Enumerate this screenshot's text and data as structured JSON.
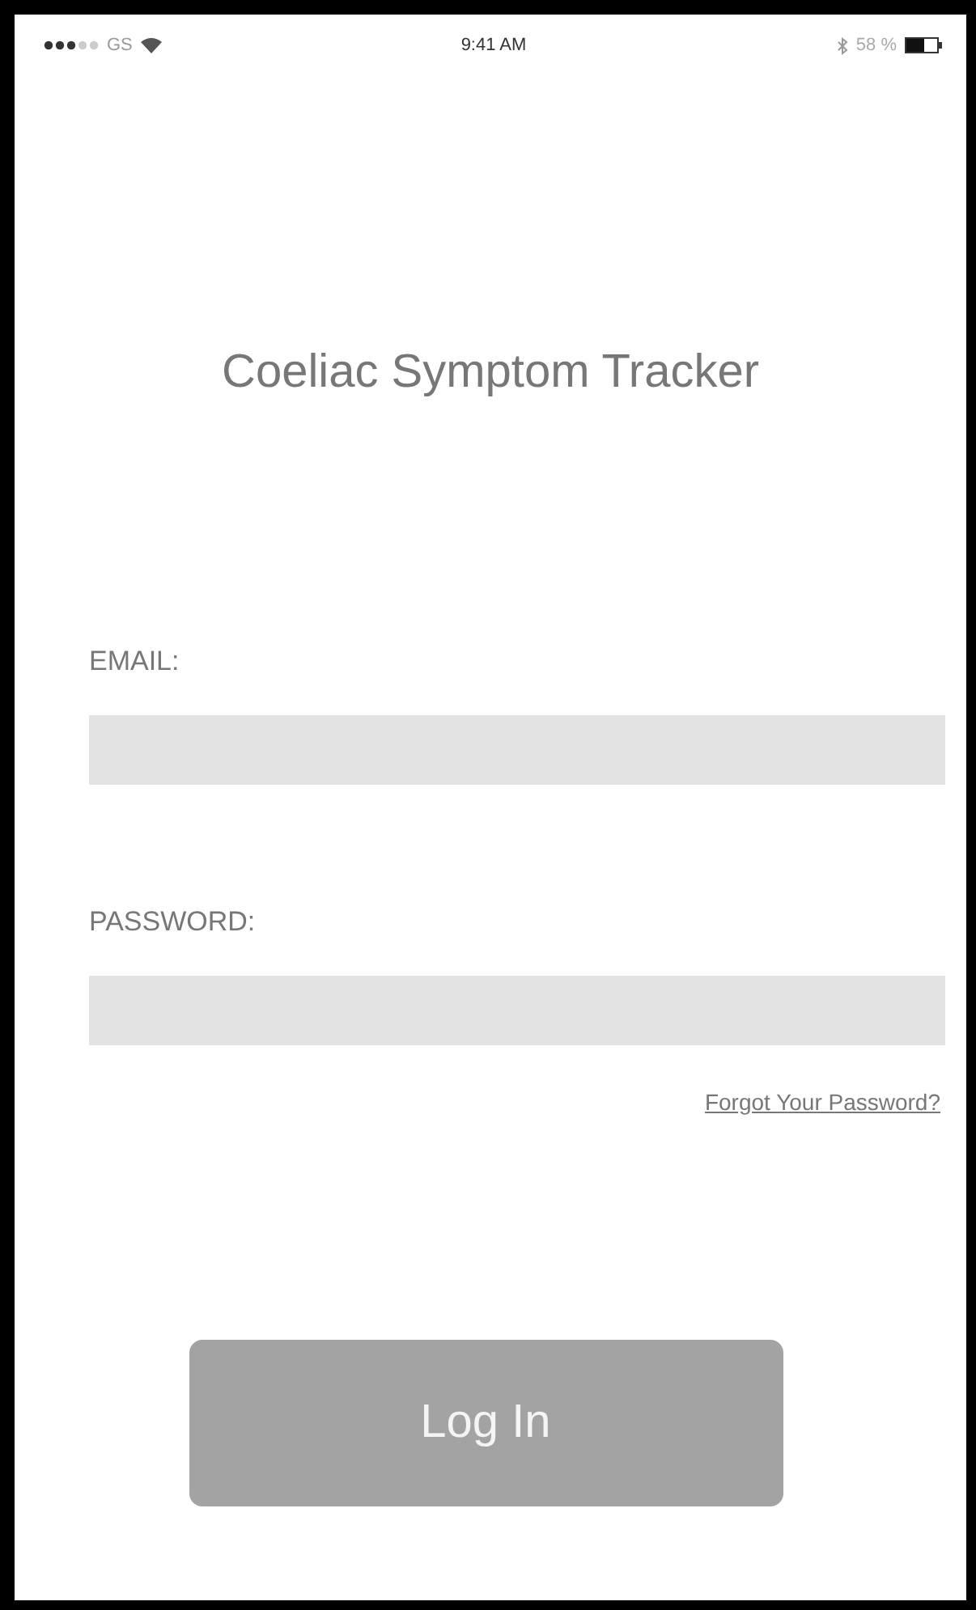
{
  "status_bar": {
    "carrier": "GS",
    "time": "9:41 AM",
    "battery": "58 %"
  },
  "title": "Coeliac Symptom Tracker",
  "fields": [
    {
      "label": "EMAIL:"
    },
    {
      "label": "PASSWORD:"
    }
  ],
  "forgot_link": "Forgot Your Password?",
  "login_button": "Log In"
}
